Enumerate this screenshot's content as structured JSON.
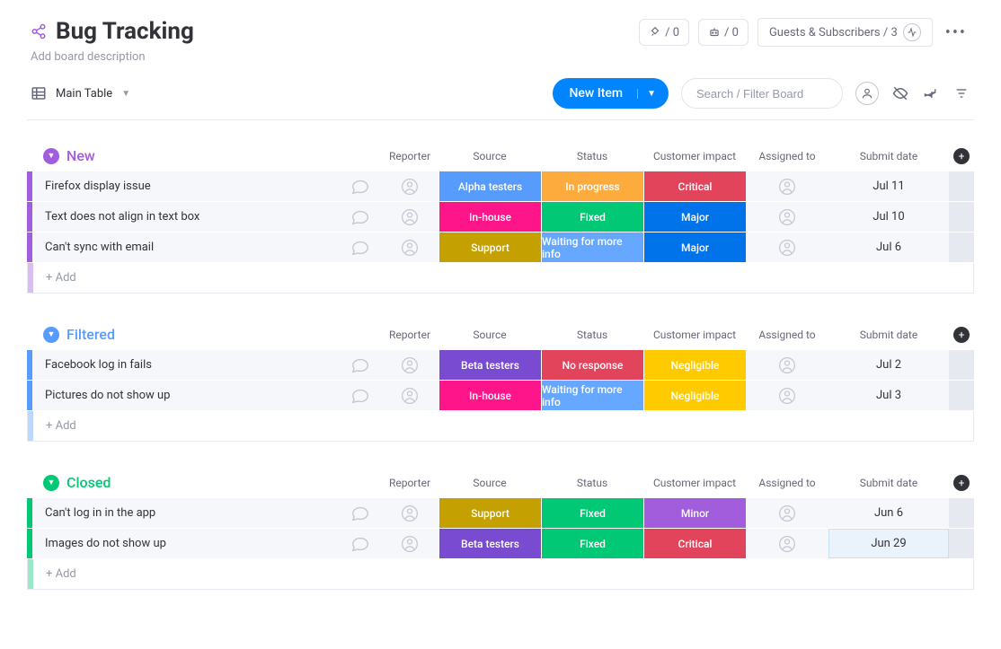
{
  "header": {
    "title": "Bug Tracking",
    "description_placeholder": "Add board description",
    "integration_a": "/ 0",
    "integration_b": "/ 0",
    "guests_label": "Guests & Subscribers / 3"
  },
  "toolbar": {
    "view_label": "Main Table",
    "new_item_label": "New Item",
    "search_placeholder": "Search / Filter Board"
  },
  "columns": {
    "reporter": "Reporter",
    "source": "Source",
    "status": "Status",
    "impact": "Customer impact",
    "assigned": "Assigned to",
    "date": "Submit date"
  },
  "add_row_label": "+ Add",
  "groups": [
    {
      "name": "New",
      "color": "#a25ddc",
      "rows": [
        {
          "name": "Firefox display issue",
          "source": {
            "t": "Alpha testers",
            "c": "c-blue"
          },
          "status": {
            "t": "In progress",
            "c": "c-orange"
          },
          "impact": {
            "t": "Critical",
            "c": "c-red"
          },
          "date": "Jul 11"
        },
        {
          "name": "Text does not align in text box",
          "source": {
            "t": "In-house",
            "c": "c-magenta"
          },
          "status": {
            "t": "Fixed",
            "c": "c-green"
          },
          "impact": {
            "t": "Major",
            "c": "c-navy"
          },
          "date": "Jul 10"
        },
        {
          "name": "Can't sync with email",
          "source": {
            "t": "Support",
            "c": "c-olive"
          },
          "status": {
            "t": "Waiting for more info",
            "c": "c-bluelt"
          },
          "impact": {
            "t": "Major",
            "c": "c-navy"
          },
          "date": "Jul 6"
        }
      ]
    },
    {
      "name": "Filtered",
      "color": "#579bfc",
      "rows": [
        {
          "name": "Facebook log in fails",
          "source": {
            "t": "Beta testers",
            "c": "c-purple"
          },
          "status": {
            "t": "No response",
            "c": "c-red"
          },
          "impact": {
            "t": "Negligible",
            "c": "c-yellow"
          },
          "date": "Jul 2"
        },
        {
          "name": "Pictures do not show up",
          "source": {
            "t": "In-house",
            "c": "c-magenta"
          },
          "status": {
            "t": "Waiting for more info",
            "c": "c-bluelt"
          },
          "impact": {
            "t": "Negligible",
            "c": "c-yellow"
          },
          "date": "Jul 3"
        }
      ]
    },
    {
      "name": "Closed",
      "color": "#00c875",
      "rows": [
        {
          "name": "Can't log in in the app",
          "source": {
            "t": "Support",
            "c": "c-olive"
          },
          "status": {
            "t": "Fixed",
            "c": "c-green"
          },
          "impact": {
            "t": "Minor",
            "c": "c-violet"
          },
          "date": "Jun 6"
        },
        {
          "name": "Images do not show up",
          "source": {
            "t": "Beta testers",
            "c": "c-purple"
          },
          "status": {
            "t": "Fixed",
            "c": "c-green"
          },
          "impact": {
            "t": "Critical",
            "c": "c-red"
          },
          "date": "Jun 29",
          "date_selected": true
        }
      ]
    }
  ]
}
